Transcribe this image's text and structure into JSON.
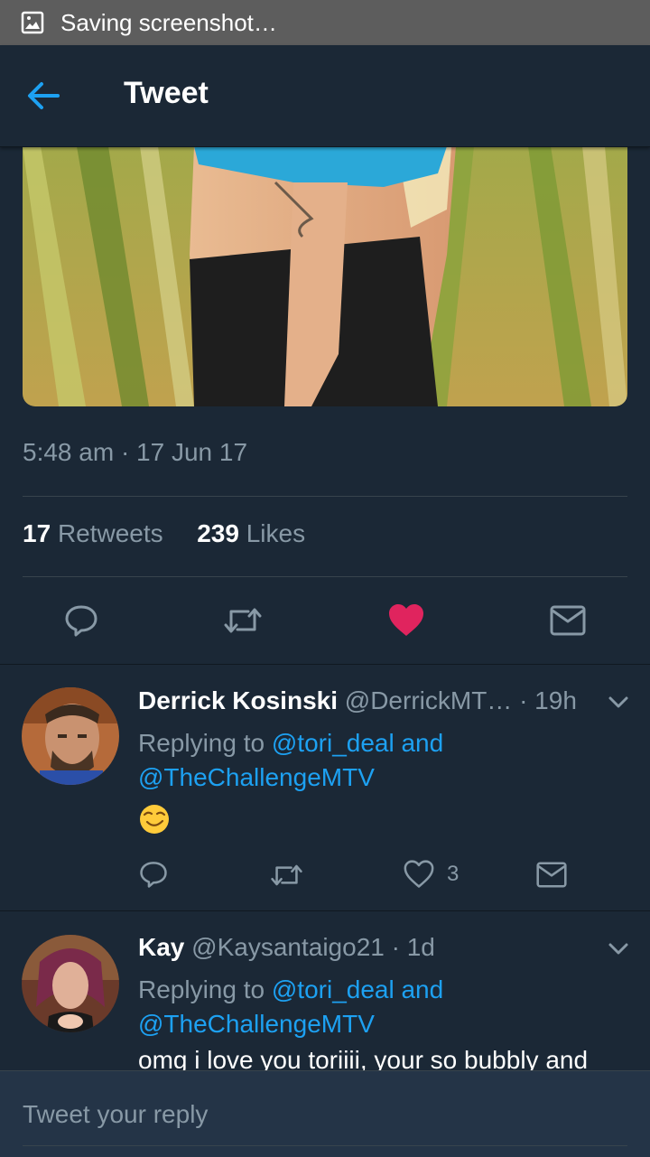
{
  "status_bar": {
    "notification_text": "Saving screenshot…"
  },
  "header": {
    "title": "Tweet"
  },
  "tweet": {
    "timestamp": "5:48 am · 17 Jun 17",
    "retweet_count": "17",
    "retweet_label": "Retweets",
    "like_count": "239",
    "like_label": "Likes",
    "liked": true,
    "like_color": "#e0245e"
  },
  "replies": [
    {
      "name": "Derrick Kosinski",
      "handle": "@DerrickMT…",
      "time": "· 19h",
      "replying_prefix": "Replying to",
      "mention1": "@tori_deal and",
      "mention2": "@TheChallengeMTV",
      "text": "",
      "emoji": "smirk-emoji",
      "like_count": "3"
    },
    {
      "name": "Kay",
      "handle": "@Kaysantaigo21",
      "time": "· 1d",
      "replying_prefix": "Replying to",
      "mention1": "@tori_deal and",
      "mention2": "@TheChallengeMTV",
      "text": "omg i love you toriiii, your so bubbly and"
    }
  ],
  "reply_box": {
    "placeholder": "Tweet your reply"
  },
  "colors": {
    "background": "#1b2836",
    "accent": "#1da1f2",
    "secondary_text": "#8899a6"
  }
}
